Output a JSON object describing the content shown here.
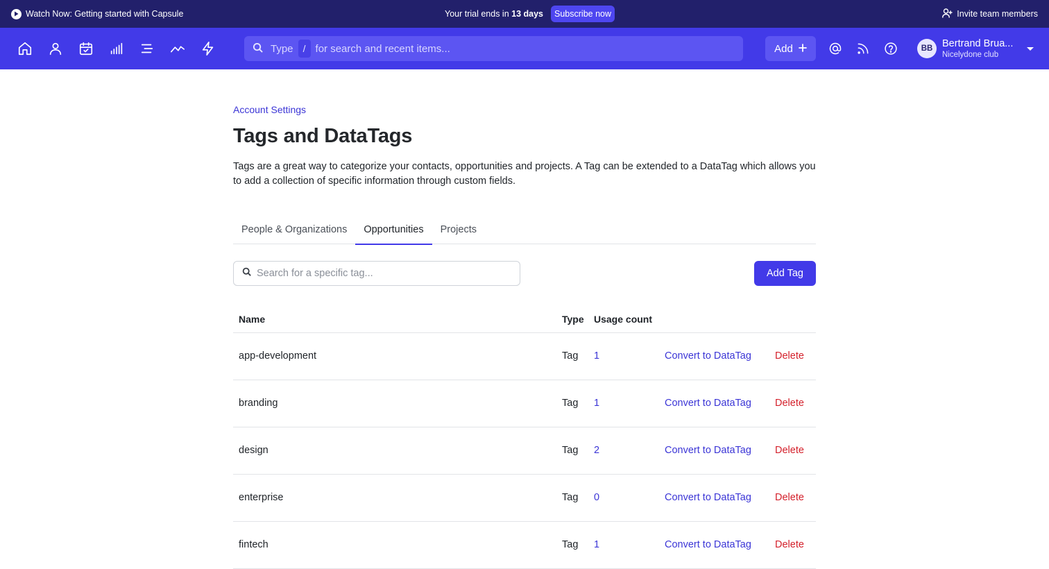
{
  "promo": {
    "watch_text": "Watch Now: Getting started with Capsule",
    "trial_prefix": "Your trial ends in",
    "trial_days": "13 days",
    "subscribe_label": "Subscribe now",
    "invite_label": "Invite team members"
  },
  "nav": {
    "icons": [
      "home-icon",
      "person-icon",
      "calendar-check-icon",
      "bar-chart-icon",
      "list-icon",
      "trend-line-icon",
      "lightning-icon"
    ],
    "search": {
      "prefix": "Type",
      "shortcut": "/",
      "suffix": "for search and recent items..."
    },
    "add_label": "Add",
    "right_icons": [
      "mention-icon",
      "feed-icon",
      "help-icon"
    ],
    "user": {
      "initials": "BB",
      "name": "Bertrand Brua...",
      "org": "Nicelydone club"
    }
  },
  "colors": {
    "promo_bg": "#22206b",
    "nav_bg": "#423ae8",
    "accent": "#423ae8",
    "link": "#3b35d6",
    "danger": "#d4202b"
  },
  "page": {
    "breadcrumb": "Account Settings",
    "title": "Tags and DataTags",
    "description": "Tags are a great way to categorize your contacts, opportunities and projects. A Tag can be extended to a DataTag which allows you to add a collection of specific information through custom fields.",
    "tabs": [
      {
        "label": "People & Organizations",
        "active": false
      },
      {
        "label": "Opportunities",
        "active": true
      },
      {
        "label": "Projects",
        "active": false
      }
    ],
    "tag_search_placeholder": "Search for a specific tag...",
    "add_tag_label": "Add Tag"
  },
  "table": {
    "headers": {
      "name": "Name",
      "type": "Type",
      "usage": "Usage count"
    },
    "convert_label": "Convert to DataTag",
    "delete_label": "Delete",
    "rows": [
      {
        "name": "app-development",
        "type": "Tag",
        "count": "1"
      },
      {
        "name": "branding",
        "type": "Tag",
        "count": "1"
      },
      {
        "name": "design",
        "type": "Tag",
        "count": "2"
      },
      {
        "name": "enterprise",
        "type": "Tag",
        "count": "0"
      },
      {
        "name": "fintech",
        "type": "Tag",
        "count": "1"
      }
    ]
  }
}
